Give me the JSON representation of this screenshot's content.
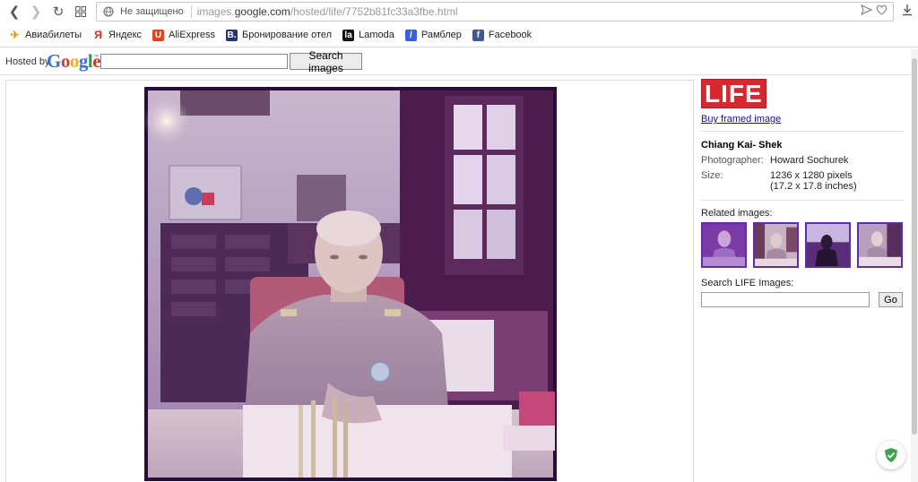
{
  "browser": {
    "insecure_label": "Не защищено",
    "url_prefix": "images.",
    "url_host": "google.com",
    "url_path": "/hosted/life/7752b81fc33a3fbe.html"
  },
  "bookmarks": [
    {
      "label": "Авиабилеты",
      "icon": "plane-icon",
      "color": "#e0a200"
    },
    {
      "label": "Яндекс",
      "icon": "yandex-icon",
      "color": "#e0261d"
    },
    {
      "label": "AliExpress",
      "icon": "aliexpress-icon",
      "color": "#e5421d"
    },
    {
      "label": "Бронирование отел",
      "icon": "booking-icon",
      "color": "#24346f"
    },
    {
      "label": "Lamoda",
      "icon": "lamoda-icon",
      "color": "#111111"
    },
    {
      "label": "Рамблер",
      "icon": "rambler-icon",
      "color": "#3b5ed9"
    },
    {
      "label": "Facebook",
      "icon": "facebook-icon",
      "color": "#3b5998"
    }
  ],
  "google_bar": {
    "hosted_by": "Hosted by",
    "logo_text": "Google",
    "search_value": "",
    "search_button": "Search images"
  },
  "info": {
    "logo": "LIFE",
    "buy_link": "Buy framed image",
    "title": "Chiang Kai- Shek",
    "photographer_label": "Photographer:",
    "photographer": "Howard Sochurek",
    "size_label": "Size:",
    "size_pixels": "1236 x 1280 pixels",
    "size_inches": "(17.2 x 17.8 inches)",
    "related_title": "Related images:",
    "search_title": "Search LIFE Images:",
    "search_value": "",
    "go_button": "Go"
  },
  "colors": {
    "life_red": "#d7282f",
    "link_blue": "#1a0dab",
    "photo_tint": "#6a3a8c"
  }
}
